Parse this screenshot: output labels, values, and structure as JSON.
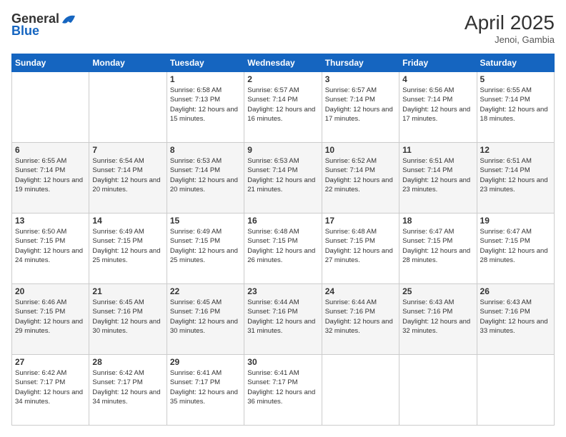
{
  "header": {
    "logo_general": "General",
    "logo_blue": "Blue",
    "month_year": "April 2025",
    "location": "Jenoi, Gambia"
  },
  "days_of_week": [
    "Sunday",
    "Monday",
    "Tuesday",
    "Wednesday",
    "Thursday",
    "Friday",
    "Saturday"
  ],
  "weeks": [
    [
      {
        "day": "",
        "sunrise": "",
        "sunset": "",
        "daylight": ""
      },
      {
        "day": "",
        "sunrise": "",
        "sunset": "",
        "daylight": ""
      },
      {
        "day": "1",
        "sunrise": "Sunrise: 6:58 AM",
        "sunset": "Sunset: 7:13 PM",
        "daylight": "Daylight: 12 hours and 15 minutes."
      },
      {
        "day": "2",
        "sunrise": "Sunrise: 6:57 AM",
        "sunset": "Sunset: 7:14 PM",
        "daylight": "Daylight: 12 hours and 16 minutes."
      },
      {
        "day": "3",
        "sunrise": "Sunrise: 6:57 AM",
        "sunset": "Sunset: 7:14 PM",
        "daylight": "Daylight: 12 hours and 17 minutes."
      },
      {
        "day": "4",
        "sunrise": "Sunrise: 6:56 AM",
        "sunset": "Sunset: 7:14 PM",
        "daylight": "Daylight: 12 hours and 17 minutes."
      },
      {
        "day": "5",
        "sunrise": "Sunrise: 6:55 AM",
        "sunset": "Sunset: 7:14 PM",
        "daylight": "Daylight: 12 hours and 18 minutes."
      }
    ],
    [
      {
        "day": "6",
        "sunrise": "Sunrise: 6:55 AM",
        "sunset": "Sunset: 7:14 PM",
        "daylight": "Daylight: 12 hours and 19 minutes."
      },
      {
        "day": "7",
        "sunrise": "Sunrise: 6:54 AM",
        "sunset": "Sunset: 7:14 PM",
        "daylight": "Daylight: 12 hours and 20 minutes."
      },
      {
        "day": "8",
        "sunrise": "Sunrise: 6:53 AM",
        "sunset": "Sunset: 7:14 PM",
        "daylight": "Daylight: 12 hours and 20 minutes."
      },
      {
        "day": "9",
        "sunrise": "Sunrise: 6:53 AM",
        "sunset": "Sunset: 7:14 PM",
        "daylight": "Daylight: 12 hours and 21 minutes."
      },
      {
        "day": "10",
        "sunrise": "Sunrise: 6:52 AM",
        "sunset": "Sunset: 7:14 PM",
        "daylight": "Daylight: 12 hours and 22 minutes."
      },
      {
        "day": "11",
        "sunrise": "Sunrise: 6:51 AM",
        "sunset": "Sunset: 7:14 PM",
        "daylight": "Daylight: 12 hours and 23 minutes."
      },
      {
        "day": "12",
        "sunrise": "Sunrise: 6:51 AM",
        "sunset": "Sunset: 7:14 PM",
        "daylight": "Daylight: 12 hours and 23 minutes."
      }
    ],
    [
      {
        "day": "13",
        "sunrise": "Sunrise: 6:50 AM",
        "sunset": "Sunset: 7:15 PM",
        "daylight": "Daylight: 12 hours and 24 minutes."
      },
      {
        "day": "14",
        "sunrise": "Sunrise: 6:49 AM",
        "sunset": "Sunset: 7:15 PM",
        "daylight": "Daylight: 12 hours and 25 minutes."
      },
      {
        "day": "15",
        "sunrise": "Sunrise: 6:49 AM",
        "sunset": "Sunset: 7:15 PM",
        "daylight": "Daylight: 12 hours and 25 minutes."
      },
      {
        "day": "16",
        "sunrise": "Sunrise: 6:48 AM",
        "sunset": "Sunset: 7:15 PM",
        "daylight": "Daylight: 12 hours and 26 minutes."
      },
      {
        "day": "17",
        "sunrise": "Sunrise: 6:48 AM",
        "sunset": "Sunset: 7:15 PM",
        "daylight": "Daylight: 12 hours and 27 minutes."
      },
      {
        "day": "18",
        "sunrise": "Sunrise: 6:47 AM",
        "sunset": "Sunset: 7:15 PM",
        "daylight": "Daylight: 12 hours and 28 minutes."
      },
      {
        "day": "19",
        "sunrise": "Sunrise: 6:47 AM",
        "sunset": "Sunset: 7:15 PM",
        "daylight": "Daylight: 12 hours and 28 minutes."
      }
    ],
    [
      {
        "day": "20",
        "sunrise": "Sunrise: 6:46 AM",
        "sunset": "Sunset: 7:15 PM",
        "daylight": "Daylight: 12 hours and 29 minutes."
      },
      {
        "day": "21",
        "sunrise": "Sunrise: 6:45 AM",
        "sunset": "Sunset: 7:16 PM",
        "daylight": "Daylight: 12 hours and 30 minutes."
      },
      {
        "day": "22",
        "sunrise": "Sunrise: 6:45 AM",
        "sunset": "Sunset: 7:16 PM",
        "daylight": "Daylight: 12 hours and 30 minutes."
      },
      {
        "day": "23",
        "sunrise": "Sunrise: 6:44 AM",
        "sunset": "Sunset: 7:16 PM",
        "daylight": "Daylight: 12 hours and 31 minutes."
      },
      {
        "day": "24",
        "sunrise": "Sunrise: 6:44 AM",
        "sunset": "Sunset: 7:16 PM",
        "daylight": "Daylight: 12 hours and 32 minutes."
      },
      {
        "day": "25",
        "sunrise": "Sunrise: 6:43 AM",
        "sunset": "Sunset: 7:16 PM",
        "daylight": "Daylight: 12 hours and 32 minutes."
      },
      {
        "day": "26",
        "sunrise": "Sunrise: 6:43 AM",
        "sunset": "Sunset: 7:16 PM",
        "daylight": "Daylight: 12 hours and 33 minutes."
      }
    ],
    [
      {
        "day": "27",
        "sunrise": "Sunrise: 6:42 AM",
        "sunset": "Sunset: 7:17 PM",
        "daylight": "Daylight: 12 hours and 34 minutes."
      },
      {
        "day": "28",
        "sunrise": "Sunrise: 6:42 AM",
        "sunset": "Sunset: 7:17 PM",
        "daylight": "Daylight: 12 hours and 34 minutes."
      },
      {
        "day": "29",
        "sunrise": "Sunrise: 6:41 AM",
        "sunset": "Sunset: 7:17 PM",
        "daylight": "Daylight: 12 hours and 35 minutes."
      },
      {
        "day": "30",
        "sunrise": "Sunrise: 6:41 AM",
        "sunset": "Sunset: 7:17 PM",
        "daylight": "Daylight: 12 hours and 36 minutes."
      },
      {
        "day": "",
        "sunrise": "",
        "sunset": "",
        "daylight": ""
      },
      {
        "day": "",
        "sunrise": "",
        "sunset": "",
        "daylight": ""
      },
      {
        "day": "",
        "sunrise": "",
        "sunset": "",
        "daylight": ""
      }
    ]
  ]
}
